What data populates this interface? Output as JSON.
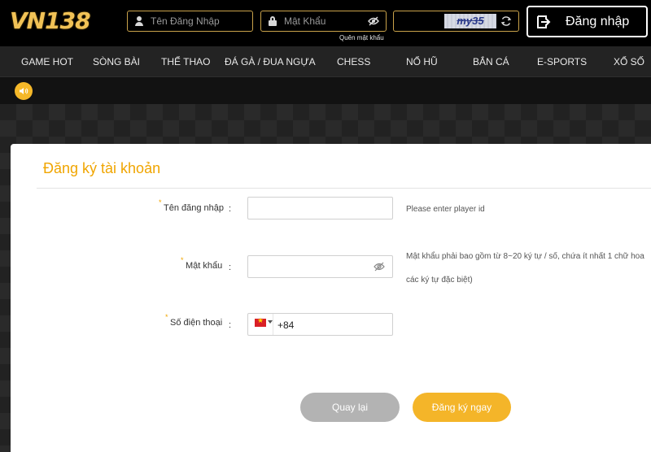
{
  "header": {
    "logo_text": "VN138",
    "username_placeholder": "Tên Đăng Nhập",
    "password_placeholder": "Mật Khẩu",
    "forgot_password": "Quên mật khẩu",
    "captcha_text": "my35",
    "login_label": "Đăng nhập"
  },
  "nav": {
    "items": [
      "GAME HOT",
      "SÒNG BÀI",
      "THỂ THAO",
      "ĐÁ GÀ / ĐUA NGỰA",
      "CHESS",
      "NỔ HŨ",
      "BẮN CÁ",
      "E-SPORTS",
      "XỔ SỐ"
    ]
  },
  "form": {
    "title": "Đăng ký tài khoản",
    "username_label": "Tên đăng nhập",
    "username_hint": "Please enter player id",
    "password_label": "Mật khẩu",
    "password_hint_line1": "Mật khẩu phải bao gồm từ 8~20 ký tự / số, chứa ít nhất 1 chữ hoa",
    "password_hint_line2": "các ký tự đặc biệt)",
    "phone_label": "Số điện thoại",
    "phone_value": "+84",
    "colon": ":",
    "required_mark": "*",
    "back_label": "Quay lại",
    "register_label": "Đăng ký ngay"
  },
  "colors": {
    "accent": "#f4b529",
    "title": "#f0a500",
    "header_bg": "#000000",
    "nav_bg": "#232323"
  }
}
